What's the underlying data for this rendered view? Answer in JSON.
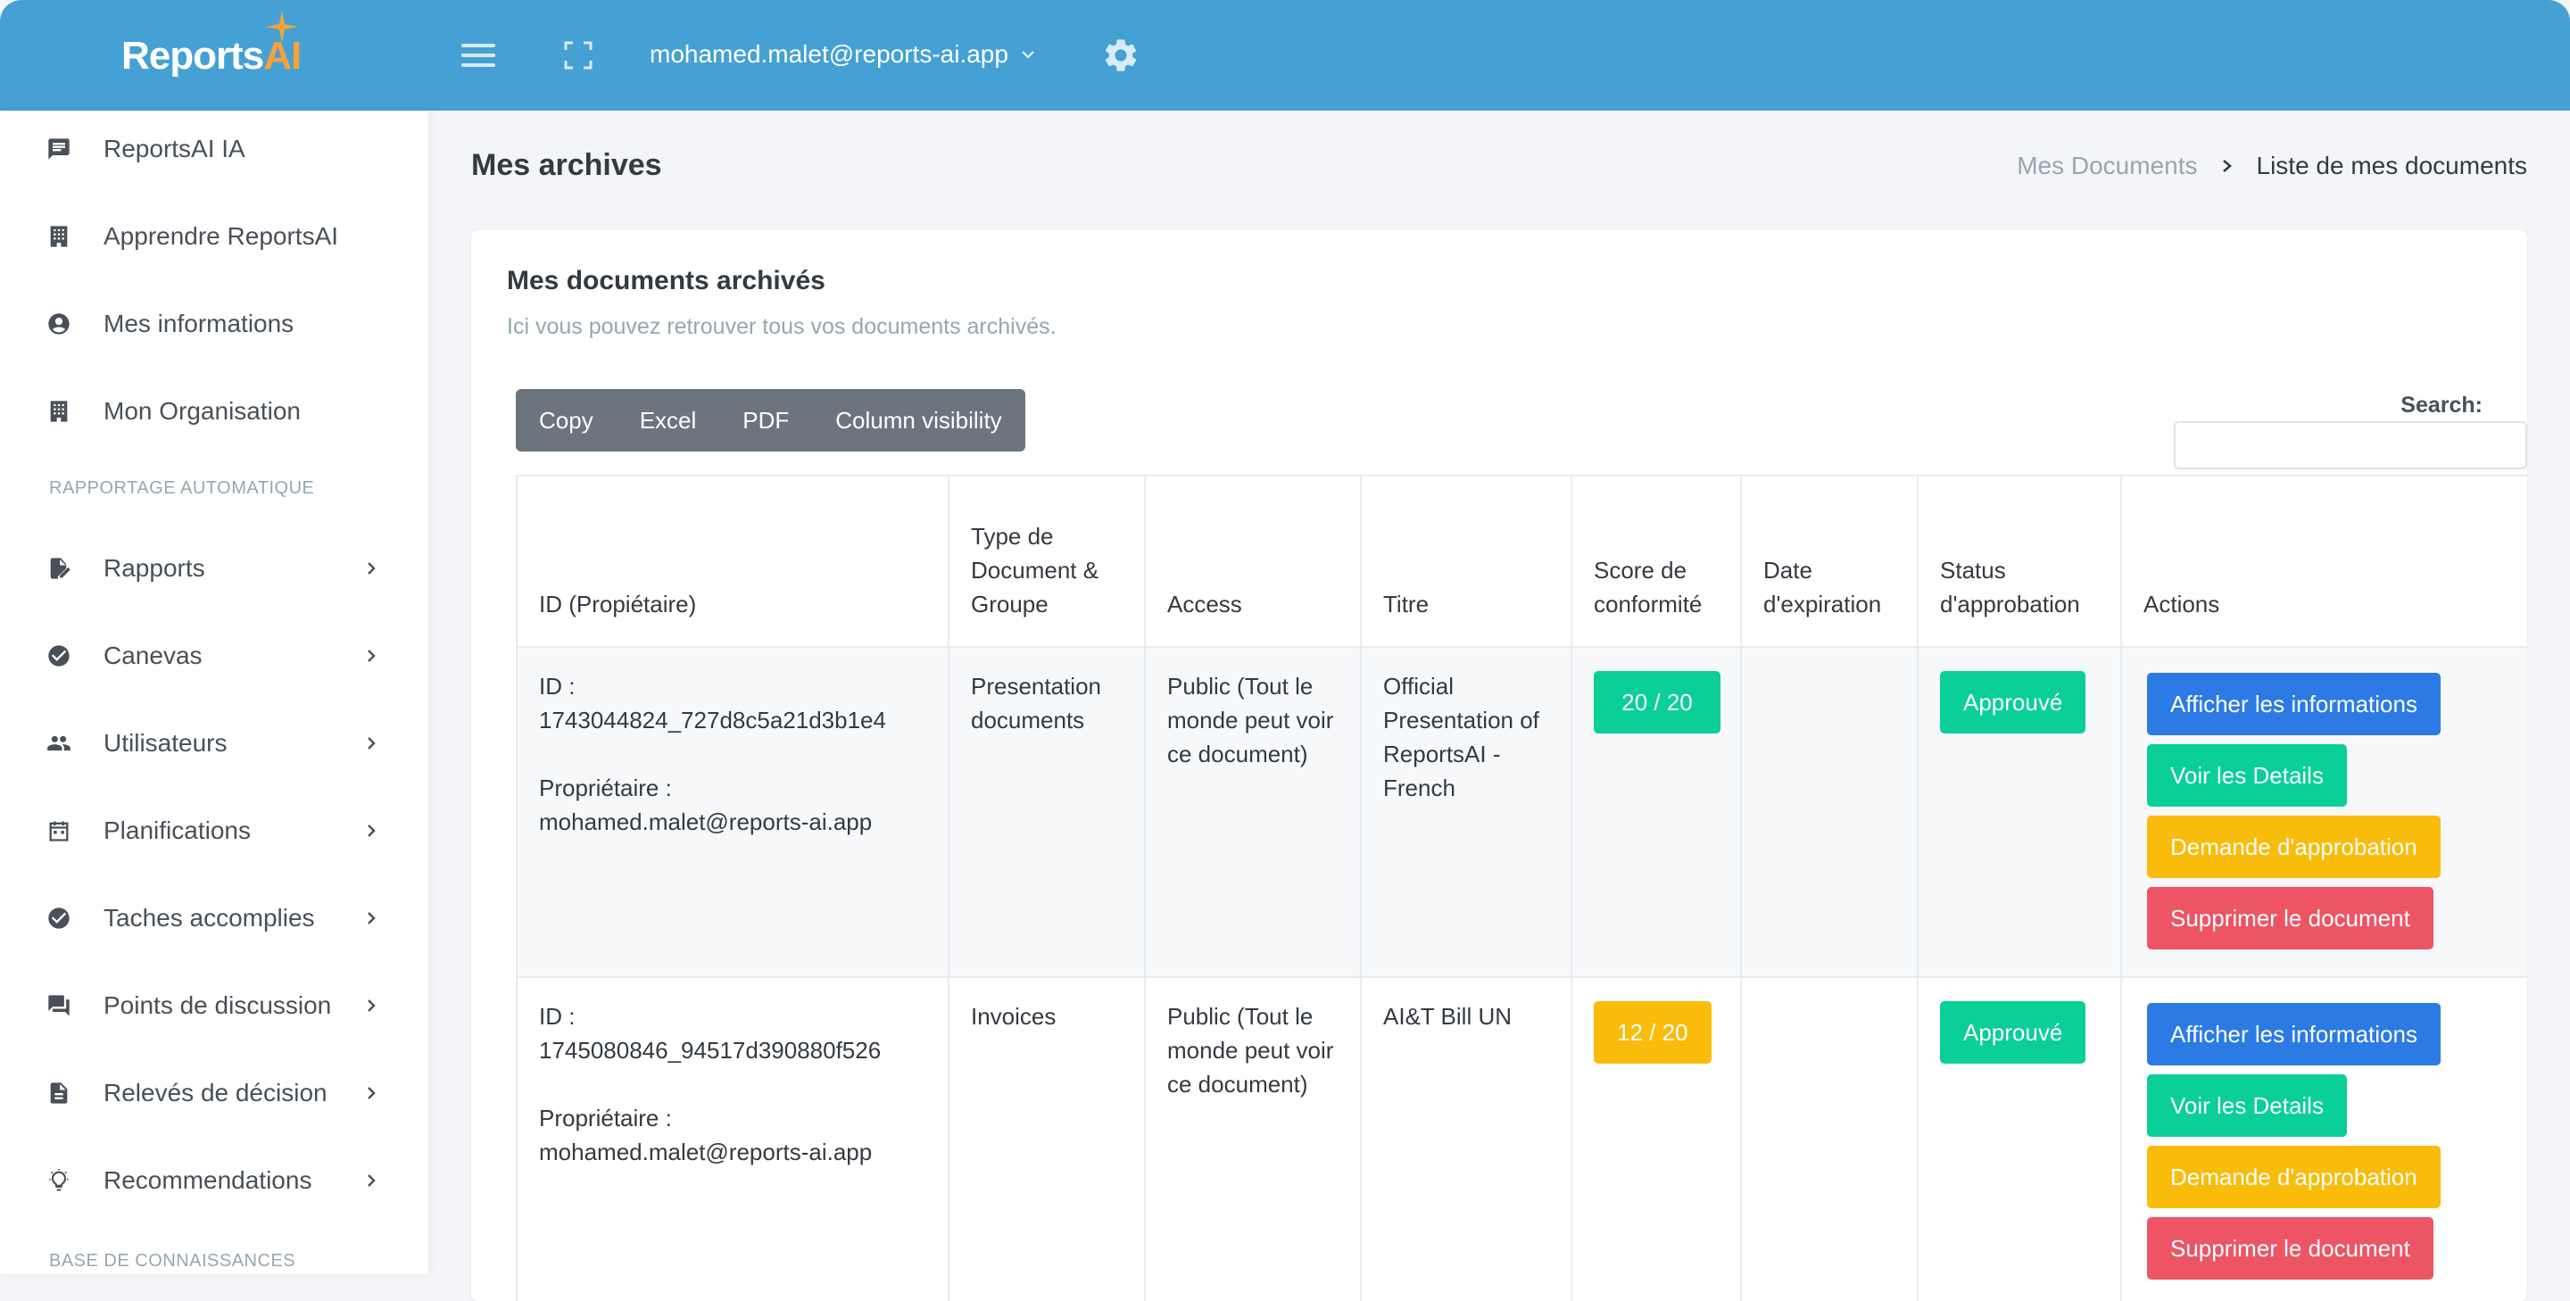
{
  "app": {
    "logo_main": "Reports",
    "logo_accent": "AI",
    "colors": {
      "header": "#45a1d4",
      "accent": "#f7a23a"
    }
  },
  "header": {
    "user_email": "mohamed.malet@reports-ai.app",
    "icons": [
      "menu-icon",
      "fullscreen-icon",
      "chevron-down-icon",
      "gear-icon"
    ]
  },
  "sidebar": {
    "items_top": [
      {
        "label": "ReportsAI IA",
        "icon": "chat-icon"
      },
      {
        "label": "Apprendre ReportsAI",
        "icon": "building-icon"
      },
      {
        "label": "Mes informations",
        "icon": "user-circle-icon"
      },
      {
        "label": "Mon Organisation",
        "icon": "building-icon"
      }
    ],
    "section1": "RAPPORTAGE AUTOMATIQUE",
    "items_section1": [
      {
        "label": "Rapports",
        "icon": "edit-document-icon"
      },
      {
        "label": "Canevas",
        "icon": "check-circle-icon"
      },
      {
        "label": "Utilisateurs",
        "icon": "users-icon"
      },
      {
        "label": "Planifications",
        "icon": "calendar-icon"
      },
      {
        "label": "Taches accomplies",
        "icon": "check-circle-icon"
      },
      {
        "label": "Points de discussion",
        "icon": "chat-bubbles-icon"
      },
      {
        "label": "Relevés de décision",
        "icon": "document-icon"
      },
      {
        "label": "Recommendations",
        "icon": "lightbulb-icon"
      }
    ],
    "section2": "BASE DE CONNAISSANCES"
  },
  "page": {
    "title": "Mes archives",
    "breadcrumb": {
      "parent": "Mes Documents",
      "current": "Liste de mes documents"
    }
  },
  "card": {
    "title": "Mes documents archivés",
    "subtitle": "Ici vous pouvez retrouver tous vos documents archivés.",
    "export_buttons": [
      "Copy",
      "Excel",
      "PDF",
      "Column visibility"
    ],
    "search_label": "Search:",
    "search_value": ""
  },
  "table": {
    "headers": [
      "ID (Propiétaire)",
      "Type de Document & Groupe",
      "Access",
      "Titre",
      "Score de conformité",
      "Date d'expiration",
      "Status d'approbation",
      "Actions"
    ],
    "rows": [
      {
        "id_label": "ID :",
        "id": "1743044824_727d8c5a21d3b1e4",
        "owner_label": "Propriétaire :",
        "owner": "mohamed.malet@reports-ai.app",
        "type": "Presentation documents",
        "access": "Public (Tout le monde peut voir ce document)",
        "title": "Official Presentation of ReportsAI - French",
        "score": "20 / 20",
        "score_color": "#0acf97",
        "expiration": "",
        "status": "Approuvé"
      },
      {
        "id_label": "ID :",
        "id": "1745080846_94517d390880f526",
        "owner_label": "Propriétaire :",
        "owner": "mohamed.malet@reports-ai.app",
        "type": "Invoices",
        "access": "Public (Tout le monde peut voir ce document)",
        "title": "AI&T Bill UN",
        "score": "12 / 20",
        "score_color": "#f9bc0b",
        "expiration": "",
        "status": "Approuvé"
      }
    ],
    "actions": [
      "Afficher les informations",
      "Voir les Details",
      "Demande d'approbation",
      "Supprimer le document"
    ]
  }
}
